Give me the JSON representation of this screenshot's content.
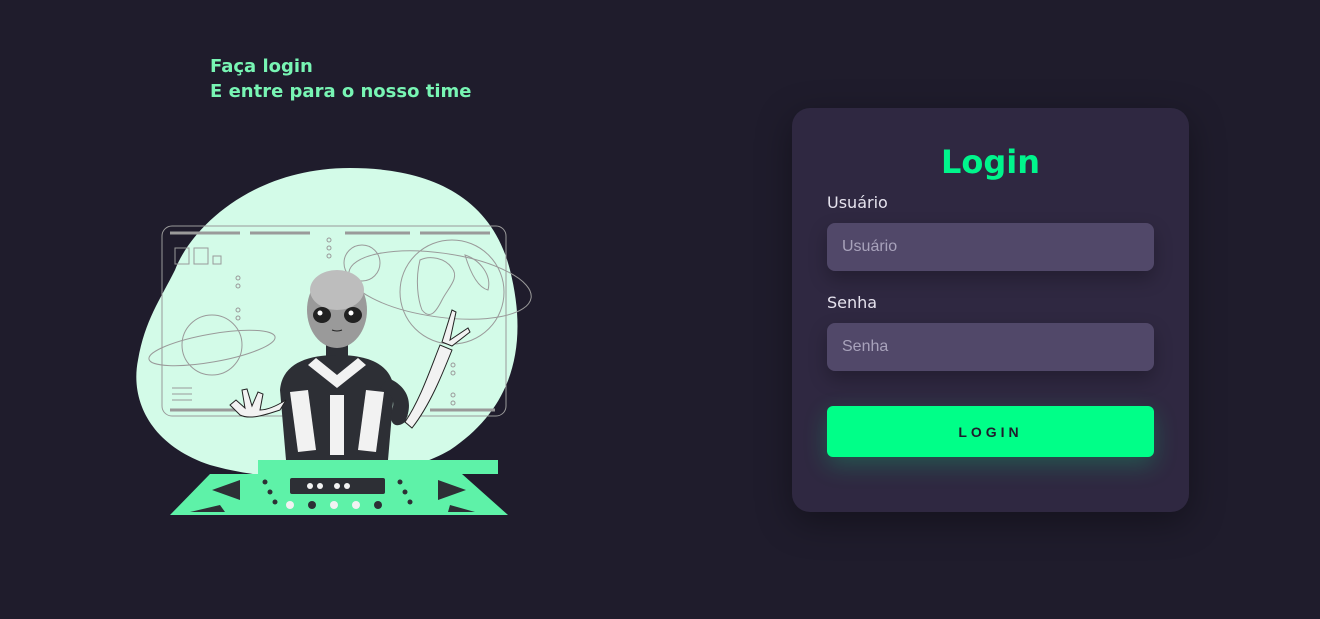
{
  "intro": {
    "line1": "Faça login",
    "line2": "E entre para o nosso time"
  },
  "illustration": {
    "name": "alien-at-control-panel-illustration"
  },
  "login_card": {
    "title": "Login",
    "username": {
      "label": "Usuário",
      "placeholder": "Usuário",
      "value": ""
    },
    "password": {
      "label": "Senha",
      "placeholder": "Senha",
      "value": ""
    },
    "submit_label": "LOGIN"
  },
  "colors": {
    "background": "#1f1c2c",
    "card": "#2f2841",
    "input": "#514869",
    "accent": "#00ff88",
    "intro_text": "#78f5b4"
  }
}
